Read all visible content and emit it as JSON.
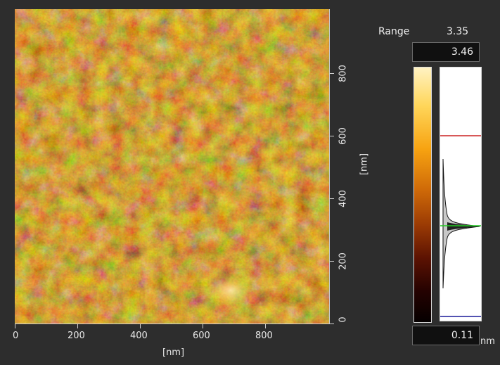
{
  "x_axis": {
    "ticks": [
      "0",
      "200",
      "400",
      "600",
      "800"
    ],
    "label": "[nm]"
  },
  "y_axis": {
    "ticks": [
      "0",
      "200",
      "400",
      "600",
      "800"
    ],
    "label": "[nm]"
  },
  "range": {
    "label": "Range",
    "value": "3.35"
  },
  "colorbar": {
    "max_value": "3.46",
    "min_value": "0.11",
    "unit": "nm",
    "colors": [
      "#fff2c2",
      "#ffd65a",
      "#f7a311",
      "#cf6a08",
      "#9a3a04",
      "#5b1202",
      "#240201",
      "#050000"
    ]
  },
  "histogram": {
    "upper_marker_color": "#cc2222",
    "center_marker_color": "#22cc22",
    "lower_marker_color": "#1a1a99"
  }
}
